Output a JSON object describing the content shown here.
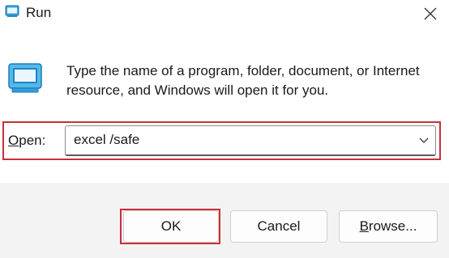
{
  "window": {
    "title": "Run",
    "icon": "run-icon",
    "close_icon": "close-icon"
  },
  "dialog": {
    "description": "Type the name of a program, folder, document, or Internet resource, and Windows will open it for you.",
    "icon": "run-icon"
  },
  "open": {
    "label_underlined": "O",
    "label_rest": "pen:",
    "value": "excel /safe",
    "dropdown_icon": "chevron-down-icon"
  },
  "buttons": {
    "ok": "OK",
    "cancel": "Cancel",
    "browse_underlined": "B",
    "browse_rest": "rowse..."
  },
  "colors": {
    "highlight": "#c8303a",
    "accent": "#2f9fdc"
  }
}
